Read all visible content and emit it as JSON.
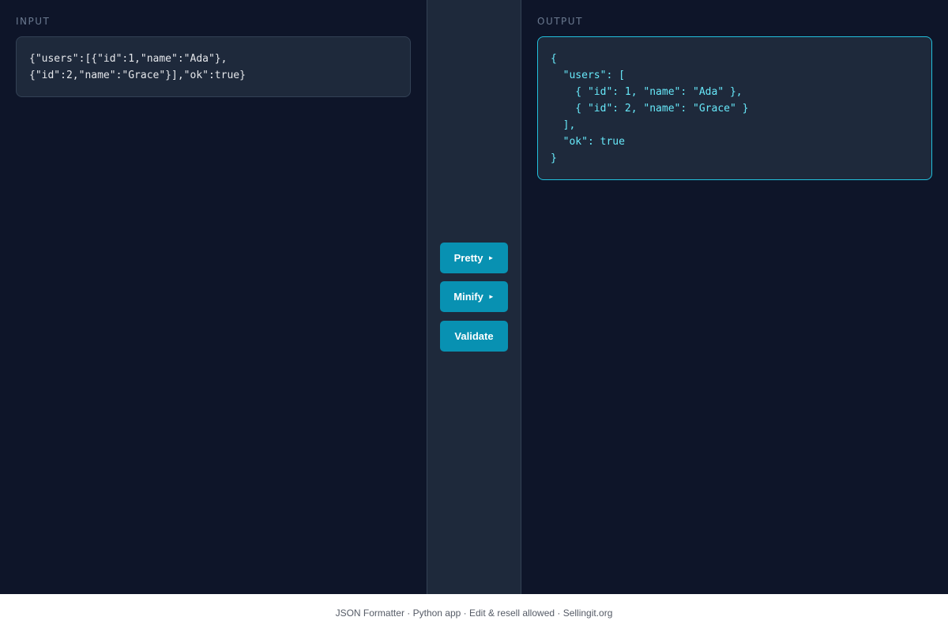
{
  "input": {
    "label": "INPUT",
    "value": "{\"users\":[{\"id\":1,\"name\":\"Ada\"},\n{\"id\":2,\"name\":\"Grace\"}],\"ok\":true}"
  },
  "output": {
    "label": "OUTPUT",
    "value": "{\n  \"users\": [\n    { \"id\": 1, \"name\": \"Ada\" },\n    { \"id\": 2, \"name\": \"Grace\" }\n  ],\n  \"ok\": true\n}"
  },
  "actions": {
    "pretty_label": "Pretty",
    "minify_label": "Minify",
    "validate_label": "Validate",
    "arrow_glyph": "►"
  },
  "footer": {
    "text": "JSON Formatter · Python app · Edit & resell allowed · Sellingit.org"
  },
  "colors": {
    "background": "#0e1529",
    "panel": "#1e293b",
    "accent": "#0891b2",
    "output_text": "#67e8f9"
  }
}
